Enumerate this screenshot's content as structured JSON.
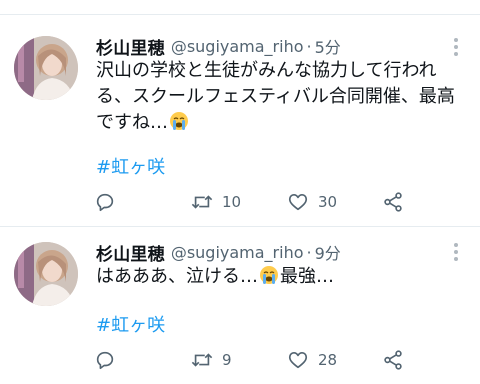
{
  "tweets": [
    {
      "display_name": "杉山里穂",
      "handle": "@sugiyama_riho",
      "separator": "·",
      "time": "5分",
      "text_line1": "沢山の学校と生徒がみんな協力して行われ",
      "text_line2": "る、スクールフェスティバル合同開催、最高",
      "text_line3": "ですね…",
      "emoji": "loudly-crying-face",
      "hashtag": "#虹ヶ咲",
      "reply_count": "",
      "retweet_count": "10",
      "like_count": "30"
    },
    {
      "display_name": "杉山里穂",
      "handle": "@sugiyama_riho",
      "separator": "·",
      "time": "9分",
      "text_before_emoji": "はあああ、泣ける…",
      "text_after_emoji": "最強…",
      "emoji": "loudly-crying-face",
      "hashtag": "#虹ヶ咲",
      "reply_count": "",
      "retweet_count": "9",
      "like_count": "28"
    }
  ],
  "icons": [
    "reply-icon",
    "retweet-icon",
    "like-icon",
    "share-icon",
    "more-options-icon"
  ],
  "colors": {
    "link": "#1d9bf0",
    "secondary_text": "#536471",
    "primary_text": "#0f1419",
    "divider": "#e6ecf0"
  }
}
